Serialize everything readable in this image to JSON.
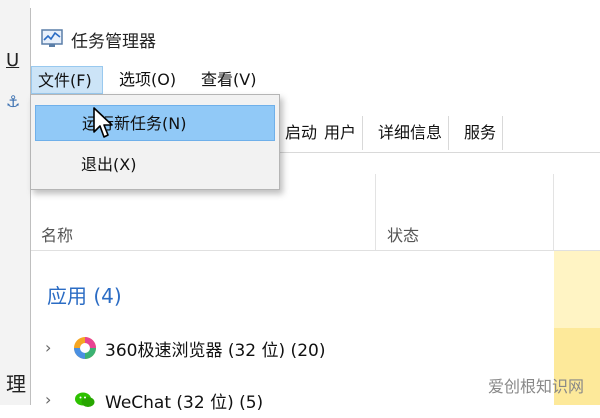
{
  "background": {
    "underline_char": "U",
    "anchor_glyph": "⚓",
    "partial_char": "理"
  },
  "window": {
    "title": "任务管理器"
  },
  "menubar": {
    "file": "文件(F)",
    "options": "选项(O)",
    "view": "查看(V)"
  },
  "dropdown": {
    "run_new_task": "运行新任务(N)",
    "exit": "退出(X)"
  },
  "tabs": [
    "启动",
    "用户",
    "详细信息",
    "服务"
  ],
  "columns": {
    "name": "名称",
    "status": "状态"
  },
  "group": {
    "title": "应用 (4)"
  },
  "rows": [
    {
      "label": "360极速浏览器 (32 位) (20)",
      "chevron": "›"
    },
    {
      "label": "WeChat (32 位) (5)",
      "chevron": "›"
    }
  ],
  "watermark": "爱创根知识网",
  "colors": {
    "accent": "#2b6cc4",
    "menu_highlight": "#91c9f7",
    "menu_active": "#cce4f7"
  }
}
